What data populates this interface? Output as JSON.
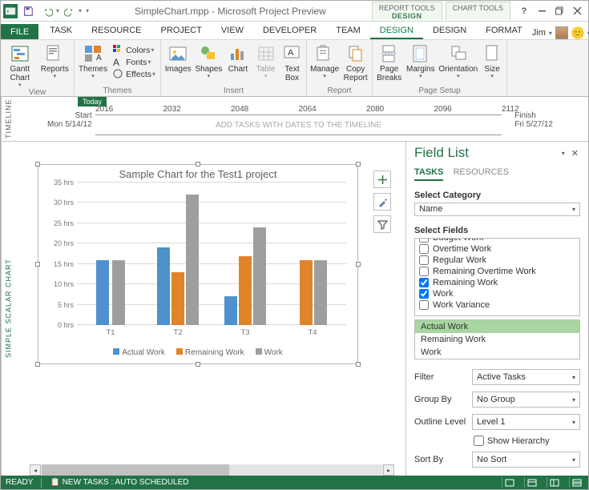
{
  "title": "SimpleChart.mpp - Microsoft Project Preview",
  "tooltabs": [
    {
      "t1": "REPORT TOOLS",
      "t2": "DESIGN"
    },
    {
      "t1": "CHART TOOLS",
      "t2": " "
    }
  ],
  "user": "Jim",
  "ribbon_tabs": {
    "file": "FILE",
    "items": [
      "TASK",
      "RESOURCE",
      "PROJECT",
      "VIEW",
      "DEVELOPER",
      "TEAM",
      "DESIGN",
      "DESIGN",
      "FORMAT"
    ],
    "active_index": 6
  },
  "ribbon": {
    "view": {
      "gantt": "Gantt\nChart",
      "reports": "Reports",
      "label": "View"
    },
    "themes": {
      "themes": "Themes",
      "colors": "Colors",
      "fonts": "Fonts",
      "effects": "Effects",
      "label": "Themes"
    },
    "insert": {
      "images": "Images",
      "shapes": "Shapes",
      "chart": "Chart",
      "table": "Table",
      "textbox": "Text\nBox",
      "label": "Insert"
    },
    "report": {
      "manage": "Manage",
      "copy": "Copy\nReport",
      "label": "Report"
    },
    "pagesetup": {
      "breaks": "Page\nBreaks",
      "margins": "Margins",
      "orient": "Orientation",
      "size": "Size",
      "label": "Page Setup"
    }
  },
  "timeline": {
    "label": "TIMELINE",
    "today": "Today",
    "start_l": "Start",
    "start_d": "Mon 5/14/12",
    "finish_l": "Finish",
    "finish_d": "Fri 5/27/12",
    "placeholder": "ADD TASKS WITH DATES TO THE TIMELINE",
    "ticks": [
      "2016",
      "2032",
      "2048",
      "2064",
      "2080",
      "2096",
      "2112"
    ]
  },
  "chart_label": "SIMPLE SCALAR CHART",
  "chart_data": {
    "type": "bar",
    "title": "Sample Chart for the Test1 project",
    "categories": [
      "T1",
      "T2",
      "T3",
      "T4"
    ],
    "series": [
      {
        "name": "Actual Work",
        "values": [
          16,
          19,
          7,
          0
        ],
        "color": "#4f91cc"
      },
      {
        "name": "Remaining Work",
        "values": [
          0,
          13,
          17,
          16
        ],
        "color": "#e08429"
      },
      {
        "name": "Work",
        "values": [
          16,
          32,
          24,
          16
        ],
        "color": "#9e9e9e"
      }
    ],
    "ylabel": "hrs",
    "ylim": [
      0,
      35
    ],
    "ystep": 5
  },
  "fieldlist": {
    "title": "Field List",
    "tabs": {
      "tasks": "TASKS",
      "resources": "RESOURCES"
    },
    "select_category_l": "Select Category",
    "category": "Name",
    "select_fields_l": "Select Fields",
    "checks": [
      {
        "label": "Budget Work",
        "checked": false,
        "cut": true
      },
      {
        "label": "Overtime Work",
        "checked": false
      },
      {
        "label": "Regular Work",
        "checked": false
      },
      {
        "label": "Remaining Overtime Work",
        "checked": false
      },
      {
        "label": "Remaining Work",
        "checked": true
      },
      {
        "label": "Work",
        "checked": true
      },
      {
        "label": "Work Variance",
        "checked": false
      }
    ],
    "selected": [
      "Actual Work",
      "Remaining Work",
      "Work"
    ],
    "filter_l": "Filter",
    "filter_v": "Active Tasks",
    "group_l": "Group By",
    "group_v": "No Group",
    "outline_l": "Outline Level",
    "outline_v": "Level 1",
    "showh": "Show Hierarchy",
    "sort_l": "Sort By",
    "sort_v": "No Sort"
  },
  "status": {
    "ready": "READY",
    "newtasks": "NEW TASKS : AUTO SCHEDULED"
  }
}
